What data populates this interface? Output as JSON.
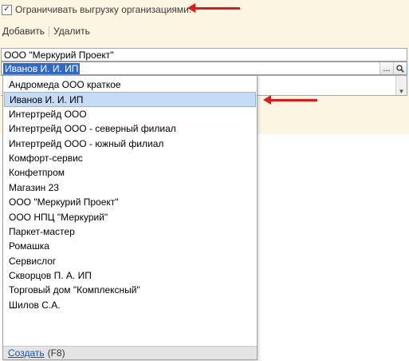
{
  "restrict": {
    "checked": true,
    "check_glyph": "✓",
    "label": "Ограничивать выгрузку организациями:"
  },
  "toolbar": {
    "add_label": "Добавить",
    "delete_label": "Удалить"
  },
  "rows": {
    "first": "ООО \"Меркурий Проект\"",
    "editing": "Иванов И. И. ИП",
    "choose_button": "...",
    "search_icon": "search-icon"
  },
  "dropdown": {
    "items": [
      "Андромеда ООО краткое",
      "Иванов И. И. ИП",
      "Интертрейд ООО",
      "Интертрейд ООО - северный филиал",
      "Интертрейд ООО - южный филиал",
      "Комфорт-сервис",
      "Конфетпром",
      "Магазин 23",
      "ООО \"Меркурий Проект\"",
      "ООО НПЦ \"Меркурий\"",
      "Паркет-мастер",
      "Ромашка",
      "Сервислог",
      "Скворцов П. А. ИП",
      "Торговый дом \"Комплексный\"",
      "Шилов С.А."
    ],
    "selected_index": 1,
    "footer_link": "Создать",
    "footer_hotkey": "(F8)"
  },
  "colors": {
    "arrow": "#e31919",
    "panel_bg": "#fbf5e1",
    "selection": "#316ac5",
    "hover": "#c5dcf7"
  }
}
